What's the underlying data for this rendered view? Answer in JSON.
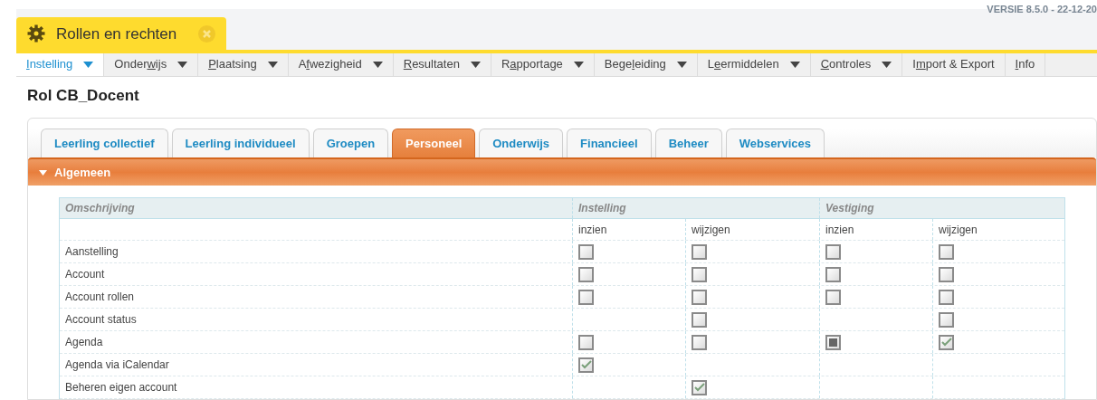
{
  "version": "VERSIE 8.5.0 - 22-12-20",
  "window_tab": {
    "title": "Rollen en rechten"
  },
  "menu": [
    {
      "access_key": "I",
      "after": "nstelling",
      "selected": true,
      "dropdown": true
    },
    {
      "before": "Onder",
      "access_key": "w",
      "after": "ijs",
      "selected": false,
      "dropdown": true
    },
    {
      "access_key": "P",
      "after": "laatsing",
      "selected": false,
      "dropdown": true
    },
    {
      "before": "A",
      "access_key": "f",
      "after": "wezigheid",
      "selected": false,
      "dropdown": true
    },
    {
      "access_key": "R",
      "after": "esultaten",
      "selected": false,
      "dropdown": true
    },
    {
      "before": "R",
      "access_key": "a",
      "after": "pportage",
      "selected": false,
      "dropdown": true
    },
    {
      "before": "Bege",
      "access_key": "l",
      "after": "eiding",
      "selected": false,
      "dropdown": true
    },
    {
      "before": "L",
      "access_key": "e",
      "after": "ermiddelen",
      "selected": false,
      "dropdown": true
    },
    {
      "access_key": "C",
      "after": "ontroles",
      "selected": false,
      "dropdown": true
    },
    {
      "before": "I",
      "access_key": "m",
      "after": "port & Export",
      "selected": false,
      "dropdown": false
    },
    {
      "access_key": "I",
      "after": "nfo",
      "selected": false,
      "dropdown": false
    }
  ],
  "page_title": "Rol CB_Docent",
  "tabs": [
    {
      "label": "Leerling collectief",
      "selected": false
    },
    {
      "label": "Leerling individueel",
      "selected": false
    },
    {
      "label": "Groepen",
      "selected": false
    },
    {
      "label": "Personeel",
      "selected": true
    },
    {
      "label": "Onderwijs",
      "selected": false
    },
    {
      "label": "Financieel",
      "selected": false
    },
    {
      "label": "Beheer",
      "selected": false
    },
    {
      "label": "Webservices",
      "selected": false
    }
  ],
  "section": {
    "title": "Algemeen",
    "expanded": true
  },
  "table": {
    "columns": [
      "Omschrijving",
      "Instelling",
      "Vestiging"
    ],
    "subcolumns": [
      "inzien",
      "wijzigen",
      "inzien",
      "wijzigen"
    ],
    "rows": [
      {
        "label": "Aanstelling",
        "cells": [
          {
            "kind": "unchecked"
          },
          {
            "kind": "unchecked"
          },
          {
            "kind": "unchecked"
          },
          {
            "kind": "unchecked"
          }
        ]
      },
      {
        "label": "Account",
        "cells": [
          {
            "kind": "unchecked"
          },
          {
            "kind": "unchecked"
          },
          {
            "kind": "unchecked"
          },
          {
            "kind": "unchecked"
          }
        ]
      },
      {
        "label": "Account rollen",
        "cells": [
          {
            "kind": "unchecked"
          },
          {
            "kind": "unchecked"
          },
          {
            "kind": "unchecked"
          },
          {
            "kind": "unchecked"
          }
        ]
      },
      {
        "label": "Account status",
        "cells": [
          {
            "kind": "none"
          },
          {
            "kind": "unchecked"
          },
          {
            "kind": "none"
          },
          {
            "kind": "unchecked"
          }
        ]
      },
      {
        "label": "Agenda",
        "cells": [
          {
            "kind": "unchecked"
          },
          {
            "kind": "unchecked"
          },
          {
            "kind": "mixed"
          },
          {
            "kind": "checked"
          }
        ]
      },
      {
        "label": "Agenda via iCalendar",
        "cells": [
          {
            "kind": "checked"
          },
          {
            "kind": "none"
          },
          {
            "kind": "none"
          },
          {
            "kind": "none"
          }
        ]
      },
      {
        "label": "Beheren eigen account",
        "cells": [
          {
            "kind": "none"
          },
          {
            "kind": "checked"
          },
          {
            "kind": "none"
          },
          {
            "kind": "none"
          }
        ]
      }
    ]
  }
}
